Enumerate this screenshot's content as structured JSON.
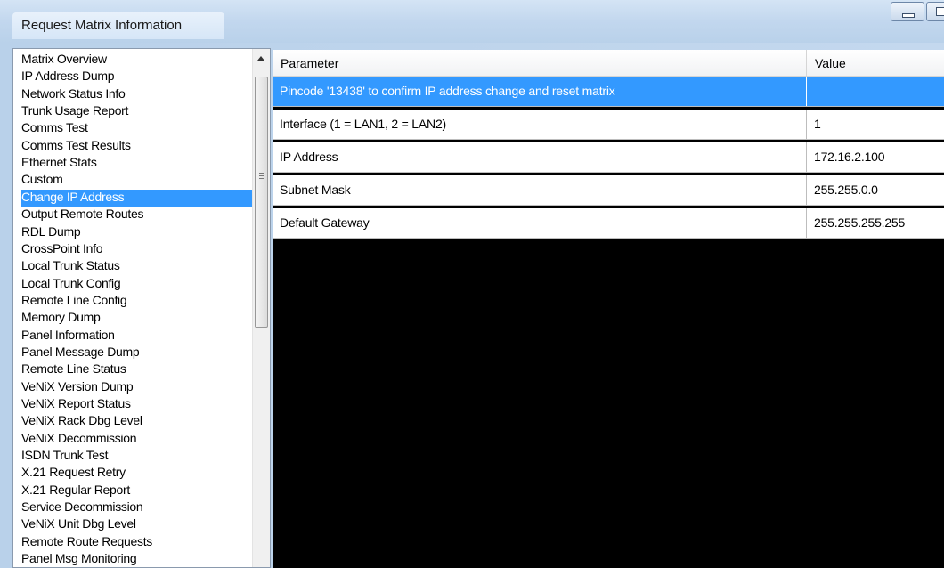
{
  "window": {
    "title": "Request Matrix Information"
  },
  "list": {
    "items": [
      "Matrix Overview",
      "IP Address Dump",
      "Network Status Info",
      "Trunk Usage Report",
      "Comms Test",
      "Comms Test Results",
      "Ethernet Stats",
      "Custom",
      "Change IP Address",
      "Output Remote Routes",
      "RDL Dump",
      "CrossPoint Info",
      "Local Trunk Status",
      "Local Trunk Config",
      "Remote Line Config",
      "Memory Dump",
      "Panel Information",
      "Panel Message Dump",
      "Remote Line Status",
      "VeNiX Version Dump",
      "VeNiX Report Status",
      "VeNiX Rack Dbg Level",
      "VeNiX Decommission",
      "ISDN Trunk Test",
      "X.21 Request Retry",
      "X.21 Regular Report",
      "Service Decommission",
      "VeNiX Unit Dbg Level",
      "Remote Route Requests",
      "Panel Msg Monitoring"
    ],
    "selected_index": 8
  },
  "grid": {
    "headers": {
      "parameter": "Parameter",
      "value": "Value"
    },
    "rows": [
      {
        "parameter": "Pincode '13438' to confirm IP address change and reset matrix",
        "value": ""
      },
      {
        "parameter": "Interface (1 = LAN1, 2 = LAN2)",
        "value": "1"
      },
      {
        "parameter": "IP Address",
        "value": "172.16.2.100"
      },
      {
        "parameter": "Subnet Mask",
        "value": "255.255.0.0"
      },
      {
        "parameter": "Default Gateway",
        "value": "255.255.255.255"
      }
    ],
    "selected_row": 0
  },
  "colors": {
    "selection": "#3399ff",
    "grid_background": "#000000"
  }
}
